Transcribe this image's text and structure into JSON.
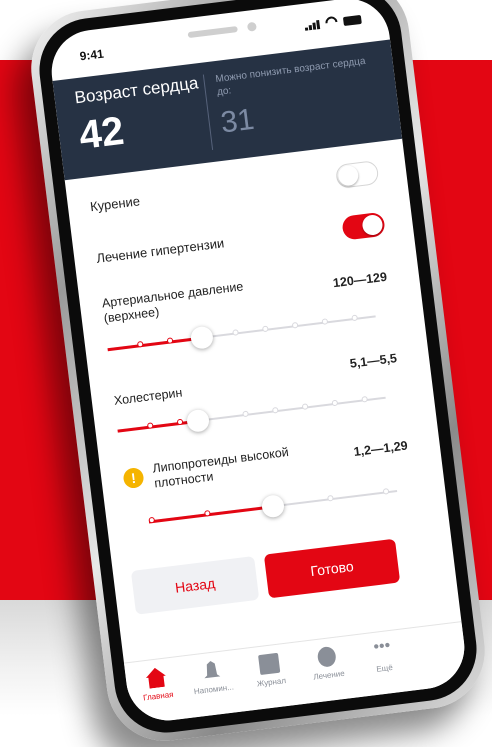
{
  "status_bar": {
    "time": "9:41"
  },
  "header": {
    "title": "Возраст сердца",
    "value": "42",
    "hint": "Можно понизить возраст сердца до:",
    "target": "31"
  },
  "toggles": [
    {
      "label": "Курение",
      "state": "off"
    },
    {
      "label": "Лечение гипертензии",
      "state": "on"
    }
  ],
  "sliders": [
    {
      "label": "Артериальное давление (верхнее)",
      "range": "120—129",
      "level": 0.35
    },
    {
      "label": "Холестерин",
      "range": "5,1—5,5",
      "level": 0.3
    },
    {
      "label": "Липопротеиды высокой плотности",
      "range": "1,2—1,29",
      "level": 0.5,
      "warning": true
    }
  ],
  "buttons": {
    "back": "Назад",
    "done": "Готово"
  },
  "tabs": [
    {
      "label": "Главная",
      "icon": "home-icon",
      "active": true
    },
    {
      "label": "Напомин...",
      "icon": "bell-icon",
      "active": false
    },
    {
      "label": "Журнал",
      "icon": "journal-icon",
      "active": false
    },
    {
      "label": "Лечение",
      "icon": "pills-icon",
      "active": false
    },
    {
      "label": "Ещё",
      "icon": "more-icon",
      "active": false
    }
  ],
  "colors": {
    "accent": "#e30613",
    "header_bg": "#263244",
    "warning": "#f5b400"
  }
}
